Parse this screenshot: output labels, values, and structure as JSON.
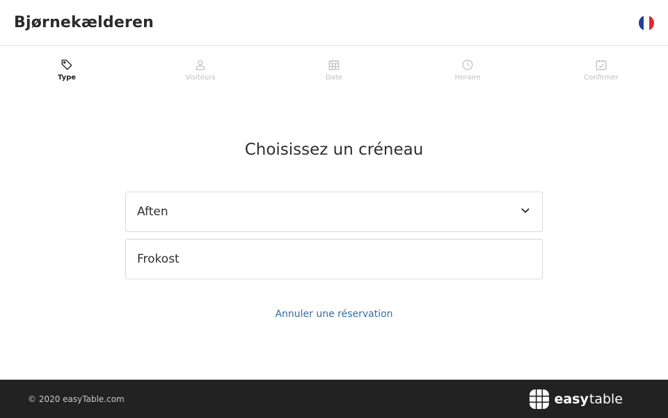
{
  "header": {
    "restaurant_name": "Bjørnekælderen",
    "language_flag": "flag-france-icon",
    "flag_colors": [
      "#1f3f99",
      "#ffffff",
      "#e3262f"
    ]
  },
  "steps": [
    {
      "label": "Type",
      "icon": "tag-icon",
      "active": true
    },
    {
      "label": "Visiteurs",
      "icon": "user-icon",
      "active": false
    },
    {
      "label": "Date",
      "icon": "calendar-icon",
      "active": false
    },
    {
      "label": "Horaire",
      "icon": "clock-icon",
      "active": false
    },
    {
      "label": "Confirmer",
      "icon": "calendar-check-icon",
      "active": false
    }
  ],
  "main": {
    "title": "Choisissez un créneau",
    "slots": [
      {
        "label": "Aften",
        "expandable": true
      },
      {
        "label": "Frokost",
        "expandable": false
      }
    ],
    "cancel_link": "Annuler une réservation"
  },
  "footer": {
    "copyright": "© 2020 easyTable.com",
    "brand_easy": "easy",
    "brand_table": "table"
  },
  "colors": {
    "link": "#2f6fa7",
    "footer_bg": "#222222",
    "inactive_step": "#bdbdbd"
  }
}
